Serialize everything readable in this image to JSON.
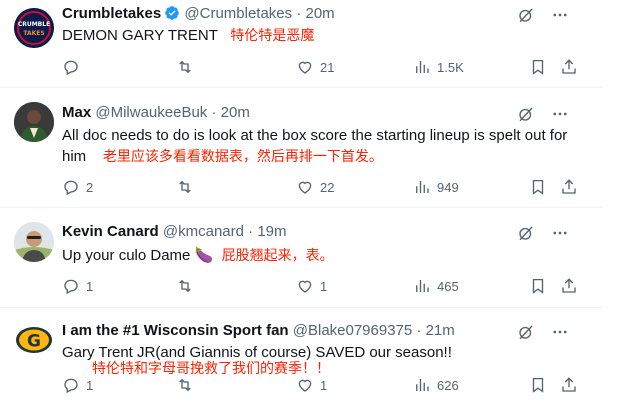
{
  "tweets": [
    {
      "name": "Crumbletakes",
      "handle": "@Crumbletakes",
      "dot": "·",
      "time": "20m",
      "text": "DEMON GARY TRENT",
      "translation": "特伦特是恶魔",
      "replies": "",
      "retweets": "",
      "likes": "21",
      "views": "1.5K"
    },
    {
      "name": "Max",
      "handle": "@MilwaukeeBuk",
      "dot": "·",
      "time": "20m",
      "text": "All doc needs to do is look at the box score the starting lineup is spelt out for him",
      "translation": "老里应该多看看数据表，然后再排一下首发。",
      "replies": "2",
      "retweets": "",
      "likes": "22",
      "views": "949"
    },
    {
      "name": "Kevin Canard",
      "handle": "@kmcanard",
      "dot": "·",
      "time": "19m",
      "text": "Up your culo Dame",
      "emoji": "🍆",
      "translation": "屁股翘起来，表。",
      "replies": "1",
      "retweets": "",
      "likes": "1",
      "views": "465"
    },
    {
      "name": "I am the #1 Wisconsin Sport fan",
      "handle": "@Blake07969375",
      "dot": "·",
      "time": "21m",
      "text": "Gary Trent JR(and Giannis of course) SAVED our season!!",
      "translation": "特伦特和字母哥挽救了我们的赛季！！",
      "replies": "1",
      "retweets": "",
      "likes": "1",
      "views": "626"
    }
  ],
  "avatars": {
    "crumble_text_top": "CRUMBLE",
    "crumble_text_bottom": "TAKES",
    "packers_letter": "G"
  },
  "colors": {
    "translation": "#ff2200",
    "verified": "#1d9bf0",
    "muted": "#536471",
    "packers_green": "#203731",
    "packers_gold": "#ffb612"
  }
}
